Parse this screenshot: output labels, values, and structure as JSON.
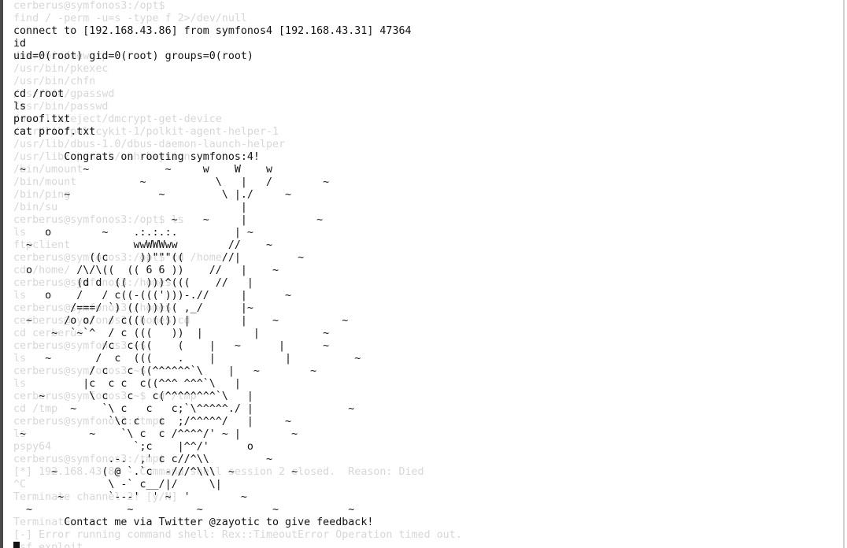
{
  "window": {
    "accent": "#4a4a4a",
    "background": "#ffffff",
    "text_color": "#111111",
    "ghost_color": "#d7d7d7"
  },
  "ghost_lines": [
    "cerberus@symfonos3:/opt$",
    "find / -perm -u=s -type f 2>/dev/null",
    "",
    "",
    "/usr/bin/newgrp",
    "/usr/bin/pkexec",
    "/usr/bin/chfn",
    "/usr/bin/gpasswd",
    "/usr/bin/passwd",
    "/usr/lib/eject/dmcrypt-get-device",
    "/usr/lib/policykit-1/polkit-agent-helper-1",
    "/usr/lib/dbus-1.0/dbus-daemon-launch-helper",
    "/usr/lib/openssh/ssh-keysign",
    "/bin/umount",
    "/bin/mount",
    "/bin/ping",
    "/bin/su",
    "cerberus@symfonos3:/opt$ ls",
    "ls",
    "ftpclient",
    "cerberus@symfonos3:/opt$ cd /home",
    "cd /home/",
    "cerberus@symfonos3:/home$",
    "ls",
    "cerberus@symfonos3:/home$",
    "cerberus@symfonos3:/home$ cd",
    "cd cerberus",
    "cerberus@symfonos3:~$",
    "ls",
    "cerberus@symfonos3:~$",
    "ls",
    "cerberus@symfonos3:~$ cd /tmp",
    "cd /tmp",
    "cerberus@symfonos3:/tmp$",
    "ls",
    "pspy64",
    "cerberus@symfonos3:/tmp$",
    "[*] 192.168.43.86 - Command shell session 2 closed.  Reason: Died",
    "^C",
    "Terminate channel 2? [y/N]",
    "",
    "Terminate",
    "[-] Error running command shell: Rex::TimeoutError Operation timed out.",
    "msf exploit"
  ],
  "output_lines": [
    "",
    "",
    "connect to [192.168.43.86] from symfonos4 [192.168.43.31] 47364",
    "id",
    "uid=0(root) gid=0(root) groups=0(root)",
    "",
    "",
    "cd /root",
    "ls",
    "proof.txt",
    "cat proof.txt",
    "",
    "        Congrats on rooting symfonos:4!",
    " ~         ~            ~     w    W    w",
    "                    ~           \\   |   /        ~",
    "        ~              ~         \\ |./     ~",
    "                                    |",
    "                         ~    ~     |           ~",
    "     o        ~    .:.:.:.         | ~",
    "  ~                wwWWWww        //    ~",
    "            ((c     ))\"\"\"((      //|         ~",
    "  o       /\\/\\((  (( 6 6 ))    //   |    ~",
    "          (d d  ((   )))^(((    //   |",
    "     o    /   / c((-(((')))-.//     |      ~",
    "         /===/ `) (( )))(( ,_/      |~",
    "  ~     /o o/  / c((( (()) |        |    ~          ~",
    "      ~  `~`^  / c (((   ))  |        |          ~",
    "              /c  c(((    (    |   ~      |      ~",
    "     ~       /  c  (((    .    |           |          ~",
    "            / c   c ((^^^^^^`\\    |   ~        ~",
    "           |c  c c  c((^^^ ^^^`\\   |",
    "    ~       \\ c   c   c(^^^^^^^^`\\   |",
    "         ~    `\\ c   c   c;`\\^^^^^./ |               ~",
    "               `\\c c   c  ;/^^^^^/   |     ~",
    " ~          ~    `\\ c  c /^^^^/' ~ |        ~",
    "                   `;c    |^^/'      o",
    "               .-.  ,' c c//^\\\\         ~",
    "      ~       ( @ `.`c  -///^\\\\\\  ~         ~",
    "               \\ -` c__/|/     \\|",
    "       ~       `---'  ' ~  '        ~",
    "  ~               ~          ~           ~           ~",
    "        Contact me via Twitter @zayotic to give feedback!",
    "",
    ""
  ]
}
